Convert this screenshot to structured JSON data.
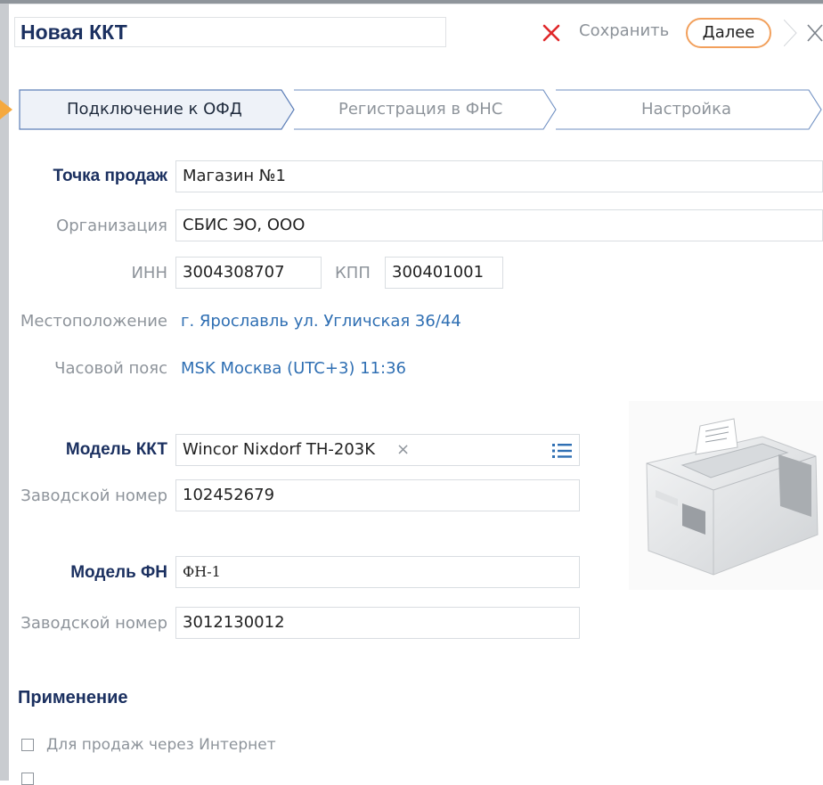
{
  "dialog": {
    "title": "Новая ККТ",
    "cancel_icon": "cross-icon",
    "save_label": "Сохранить",
    "next_label": "Далее",
    "close_icon": "close-icon"
  },
  "steps": [
    {
      "label": "Подключение к ОФД",
      "active": true
    },
    {
      "label": "Регистрация в ФНС",
      "active": false
    },
    {
      "label": "Настройка",
      "active": false
    }
  ],
  "form": {
    "point_of_sale": {
      "label": "Точка продаж",
      "value": "Магазин №1"
    },
    "organization": {
      "label": "Организация",
      "value": "СБИС ЭО, ООО"
    },
    "inn": {
      "label": "ИНН",
      "value": "3004308707"
    },
    "kpp": {
      "label": "КПП",
      "value": "300401001"
    },
    "location": {
      "label": "Местоположение",
      "value": "г. Ярославль ул. Угличская 36/44"
    },
    "timezone": {
      "label": "Часовой пояс",
      "value": "MSK Москва (UTC+3) 11:36"
    },
    "kkt_model": {
      "label": "Модель ККТ",
      "value": "Wincor Nixdorf TH-203K",
      "clear": "×",
      "list_icon": "list-icon"
    },
    "kkt_serial": {
      "label": "Заводской номер",
      "value": "102452679"
    },
    "fn_model": {
      "label": "Модель ФН",
      "value": "ФН-1"
    },
    "fn_serial": {
      "label": "Заводской номер",
      "value": "3012130012"
    }
  },
  "usage": {
    "title": "Применение",
    "options": [
      {
        "label": "Для продаж через Интернет",
        "checked": false
      }
    ]
  },
  "colors": {
    "accent": "#f2a05c",
    "title": "#1b3060",
    "link": "#2f6fb3",
    "cancel": "#e0282a"
  }
}
